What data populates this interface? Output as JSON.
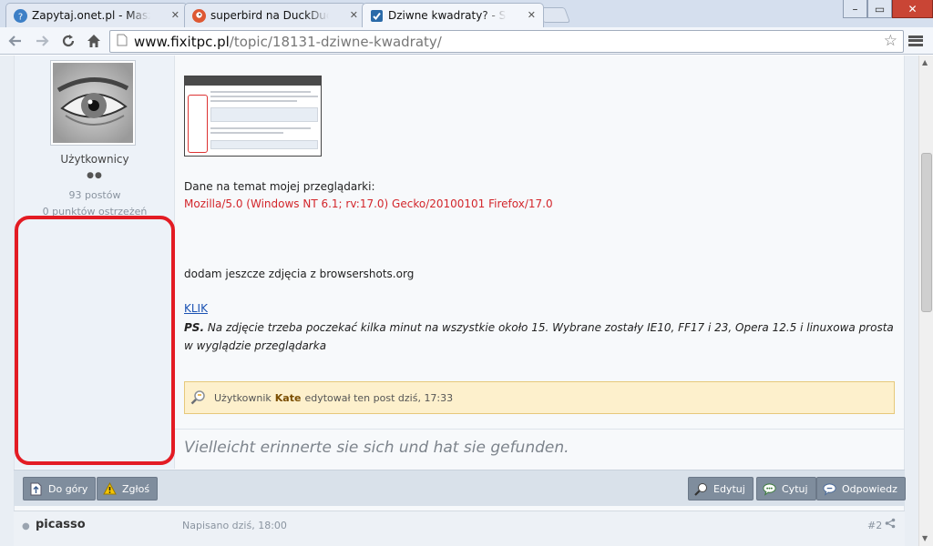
{
  "browser": {
    "tabs": [
      {
        "title": "Zapytaj.onet.pl - Masz Pytanie?",
        "icon": "question-favicon"
      },
      {
        "title": "superbird na DuckDuckGo",
        "icon": "duck-favicon"
      },
      {
        "title": "Dziwne kwadraty? - Serwis",
        "icon": "fixitpc-favicon"
      }
    ],
    "url_host": "www.fixitpc.pl",
    "url_path": "/topic/18131-dziwne-kwadraty/",
    "window_controls": [
      "–",
      "▭",
      "✕"
    ],
    "close_glyph": "✕"
  },
  "author": {
    "group": "Użytkownicy",
    "pips": "●●",
    "posts": "93 postów",
    "warnings": "0 punktów ostrzeżeń"
  },
  "post": {
    "browser_label": "Dane na temat mojej przeglądarki:",
    "user_agent": "Mozilla/5.0 (Windows NT 6.1; rv:17.0) Gecko/20100101 Firefox/17.0",
    "extra_text": "dodam jeszcze zdjęcia z browsershots.org",
    "link_text": "KLIK",
    "ps_label": "PS.",
    "ps_text": "Na zdjęcie trzeba poczekać kilka minut na wszystkie około 15. Wybrane zostały IE10, FF17 i 23, Opera 12.5 i linuxowa prosta w wyglądzie przeglądarka",
    "edit_prefix": "Użytkownik",
    "edit_user": "Kate",
    "edit_suffix": "edytował ten post dziś, 17:33",
    "signature": "Vielleicht erinnerte sie sich und hat sie gefunden."
  },
  "controls": {
    "top": "Do góry",
    "report": "Zgłoś",
    "edit": "Edytuj",
    "quote": "Cytuj",
    "reply": "Odpowiedz"
  },
  "next_post": {
    "author": "picasso",
    "date": "Napisano dziś, 18:00",
    "number": "#2"
  },
  "colors": {
    "highlight": "#e31b23",
    "user_agent": "#d3262b",
    "link": "#1a52b3",
    "button": "#7f8d9d"
  }
}
